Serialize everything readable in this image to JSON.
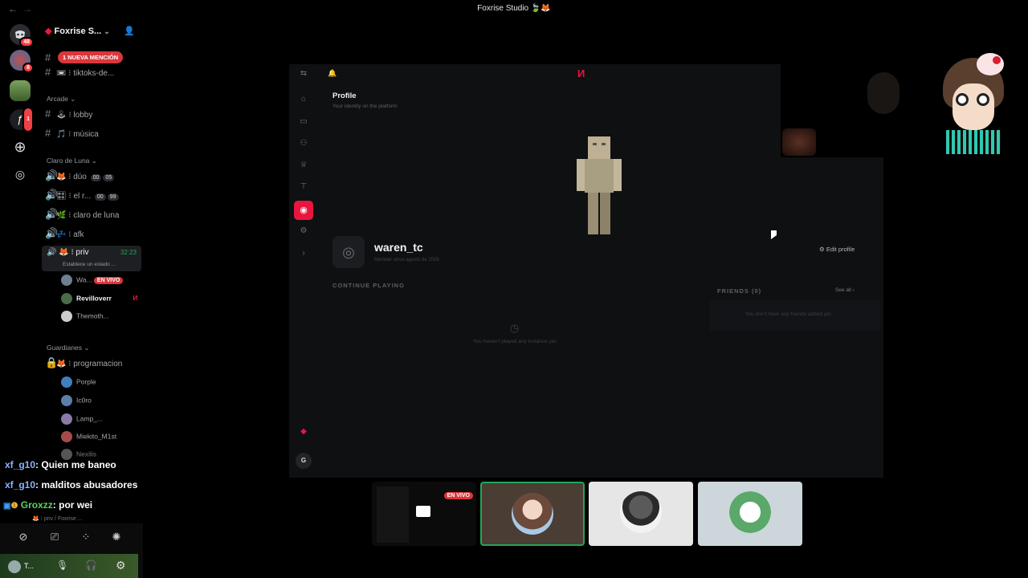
{
  "window": {
    "title": "Foxrise Studio 🍃🦊"
  },
  "rail": {
    "badges": [
      "48",
      "8",
      "1"
    ]
  },
  "channel_list": {
    "server_name": "Foxrise S...",
    "mention_banner": "1 NUEVA MENCIÓN",
    "top_channels": [
      "tiktoks-de..."
    ],
    "categories": [
      {
        "name": "Arcade",
        "channels": [
          "lobby",
          "música"
        ]
      },
      {
        "name": "Claro de Luna",
        "voice": [
          {
            "name": "dúo",
            "counts": [
              "00",
              "05"
            ]
          },
          {
            "name": "el r...",
            "counts": [
              "00",
              "99"
            ]
          },
          {
            "name": "claro de luna"
          },
          {
            "name": "afk"
          },
          {
            "name": "priv",
            "time": "32:23",
            "status": "Establece un estado ..."
          }
        ]
      },
      {
        "name": "Guardianes",
        "voice": [
          {
            "name": "programacion"
          }
        ]
      }
    ],
    "priv_users": [
      {
        "name": "Wa...",
        "live": "EN VIVO"
      },
      {
        "name": "Revilloverr"
      },
      {
        "name": "Themoth..."
      }
    ],
    "prog_users": [
      "Porple",
      "Ic0ro",
      "Lamp_...",
      "Miekito_M1st",
      "Nexilis"
    ]
  },
  "chat": [
    {
      "user": "xf_g10",
      "text": ": Quien me baneo"
    },
    {
      "user": "xf_g10",
      "text": ": malditos abusadores"
    },
    {
      "user": "Groxzz",
      "text": ": por wei"
    }
  ],
  "voice_panel": {
    "location": "priv / Foxrise ...",
    "username": "T..."
  },
  "app": {
    "profile_title": "Profile",
    "profile_subtitle": "Your identity on the platform",
    "username": "waren_tc",
    "member_since": "Member since agosto de 2026",
    "edit_profile": "Edit profile",
    "continue_playing": "CONTINUE PLAYING",
    "no_instances": "You haven't played any instance yet.",
    "friends_title": "FRIENDS (0)",
    "see_all": "See all",
    "no_friends": "You don't have any friends added yet.",
    "avatar_initial": "G"
  },
  "stage": {
    "live_label": "EN VIVO"
  },
  "colors": {
    "accent": "#e8163f",
    "live": "#da373c",
    "mention": "#f23f43",
    "speaking": "#23a55a"
  }
}
